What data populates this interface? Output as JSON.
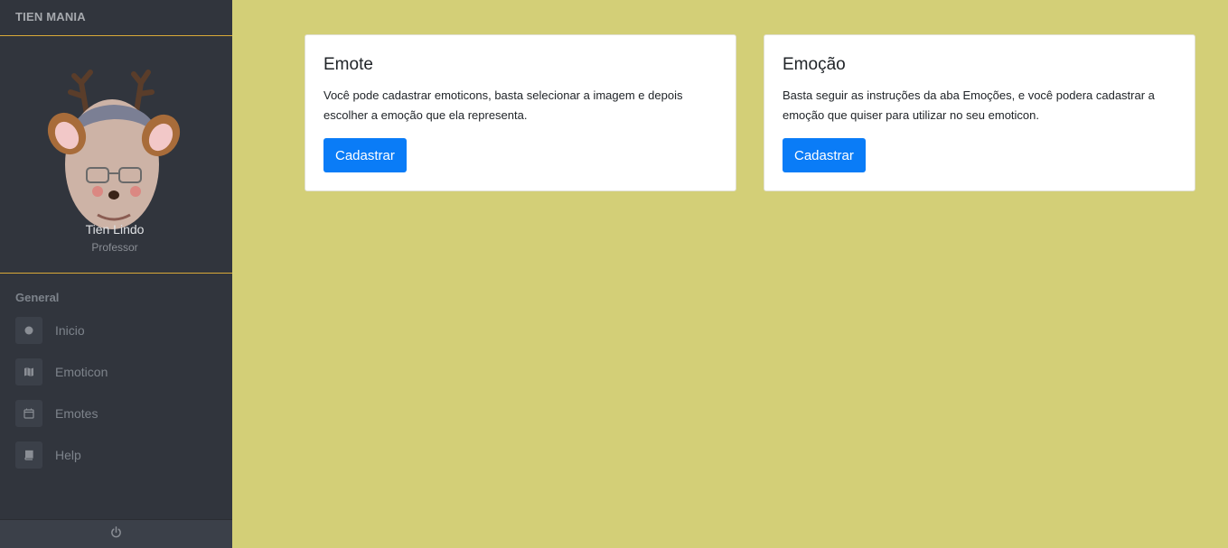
{
  "sidebar": {
    "brand": "TIEN MANIA",
    "user": {
      "name": "Tien Lindo",
      "role": "Professor"
    },
    "section_title": "General",
    "items": [
      {
        "label": "Inicio",
        "icon": "circle-icon"
      },
      {
        "label": "Emoticon",
        "icon": "map-icon"
      },
      {
        "label": "Emotes",
        "icon": "calendar-icon"
      },
      {
        "label": "Help",
        "icon": "book-icon"
      }
    ],
    "footer_icon": "power-icon"
  },
  "cards": [
    {
      "title": "Emote",
      "text": "Você pode cadastrar emoticons, basta selecionar a imagem e depois escolher a emoção que ela representa.",
      "button": "Cadastrar"
    },
    {
      "title": "Emoção",
      "text": "Basta seguir as instruções da aba Emoções, e você podera cadastrar a emoção que quiser para utilizar no seu emoticon.",
      "button": "Cadastrar"
    }
  ],
  "colors": {
    "sidebar_bg": "#31353d",
    "accent_line": "#d9a938",
    "main_bg": "#d3cf77",
    "button": "#0a7cf7"
  }
}
